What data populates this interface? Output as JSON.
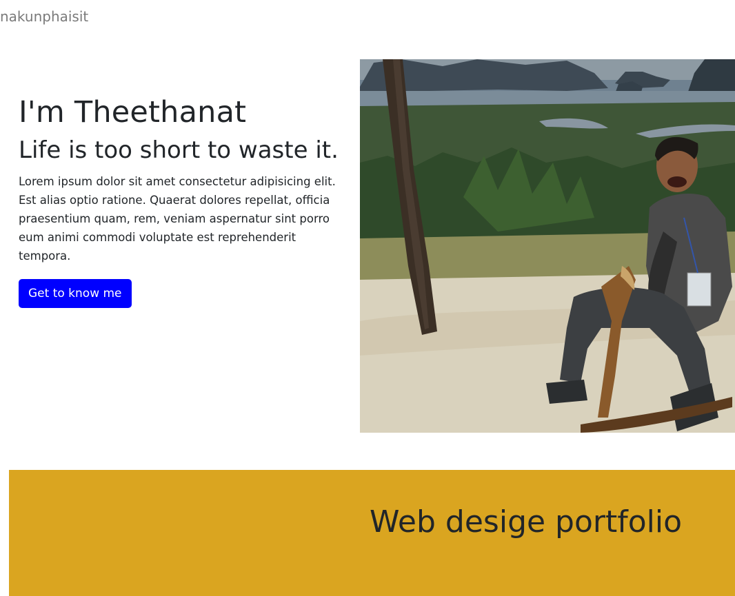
{
  "header": {
    "brand": "nakunphaisit"
  },
  "hero": {
    "title": "I'm Theethanat",
    "subtitle": "Life is too short to waste it.",
    "body": "Lorem ipsum dolor sit amet consectetur adipisicing elit. Est alias optio ratione. Quaerat dolores repellat, officia praesentium quam, rem, veniam aspernatur sint porro eum animi commodi voluptate est reprehenderit tempora.",
    "cta_label": "Get to know me",
    "cta_color": "#0000ff"
  },
  "portfolio": {
    "title": "Web desige portfolio",
    "background": "#daa520"
  }
}
